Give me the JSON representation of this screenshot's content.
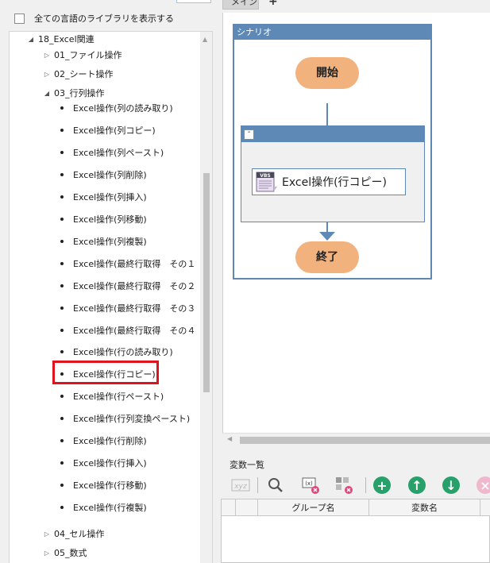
{
  "left_panel": {
    "show_all_label": "全ての言語のライブラリを表示する",
    "tree": {
      "root": "18_Excel関連",
      "folders": {
        "file_ops": "01_ファイル操作",
        "sheet_ops": "02_シート操作",
        "rowcol_ops": "03_行列操作",
        "cell_ops": "04_セル操作",
        "formula": "05_数式"
      },
      "items": [
        "Excel操作(列の読み取り)",
        "Excel操作(列コピー)",
        "Excel操作(列ペースト)",
        "Excel操作(列削除)",
        "Excel操作(列挿入)",
        "Excel操作(列移動)",
        "Excel操作(列複製)",
        "Excel操作(最終行取得　その１",
        "Excel操作(最終行取得　その２",
        "Excel操作(最終行取得　その３",
        "Excel操作(最終行取得　その４",
        "Excel操作(行の読み取り)",
        "Excel操作(行コピー)",
        "Excel操作(行ペースト)",
        "Excel操作(行列変換ペースト)",
        "Excel操作(行削除)",
        "Excel操作(行挿入)",
        "Excel操作(行移動)",
        "Excel操作(行複製)"
      ],
      "selected_item": "Excel操作(行コピー)"
    }
  },
  "tabs": {
    "main": "メイン",
    "add": "+"
  },
  "scenario": {
    "title": "シナリオ",
    "start": "開始",
    "activity_icon_text": "VBS",
    "activity": "Excel操作(行コピー)",
    "end": "終了",
    "collapse": "-"
  },
  "variables": {
    "title": "変数一覧",
    "columns": {
      "group": "グループ名",
      "name": "変数名"
    }
  },
  "colors": {
    "accent_blue": "#5e89b6",
    "terminal_orange": "#f2b27e",
    "highlight_red": "#e0141e",
    "toolbar_green": "#28a06a"
  }
}
